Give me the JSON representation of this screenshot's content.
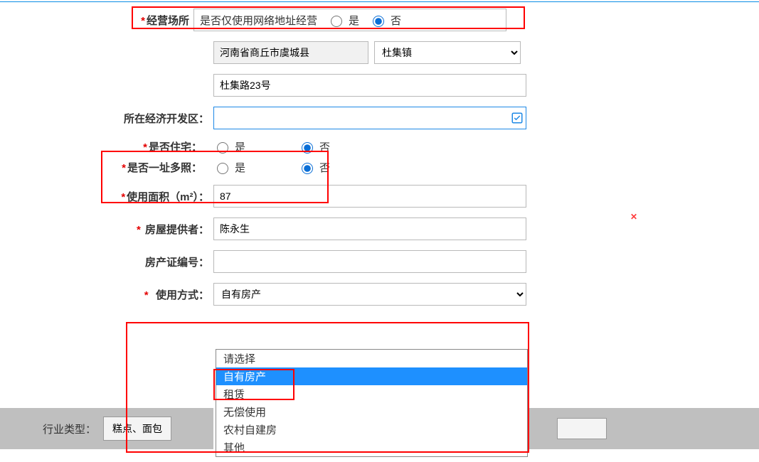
{
  "location": {
    "label": "经营场所",
    "network_question": "是否仅使用网络地址经营",
    "yes": "是",
    "no": "否",
    "region_value": "河南省商丘市虞城县",
    "town_value": "杜集镇",
    "address_value": "杜集路23号"
  },
  "dev_zone": {
    "label": "所在经济开发区：",
    "value": ""
  },
  "residence": {
    "label": "是否住宅：",
    "yes": "是",
    "no": "否"
  },
  "multi": {
    "label": "是否一址多照：",
    "yes": "是",
    "no": "否"
  },
  "area": {
    "label": "使用面积（m²）：",
    "value": "87"
  },
  "provider": {
    "label": "房屋提供者：",
    "value": "陈永生"
  },
  "cert": {
    "label": "房产证编号：",
    "value": ""
  },
  "usage": {
    "label": "使用方式：",
    "value": "自有房产",
    "options": [
      "请选择",
      "自有房产",
      "租赁",
      "无偿使用",
      "农村自建房",
      "其他"
    ]
  },
  "footer": {
    "label": "行业类型：",
    "btn": "糕点、面包"
  }
}
